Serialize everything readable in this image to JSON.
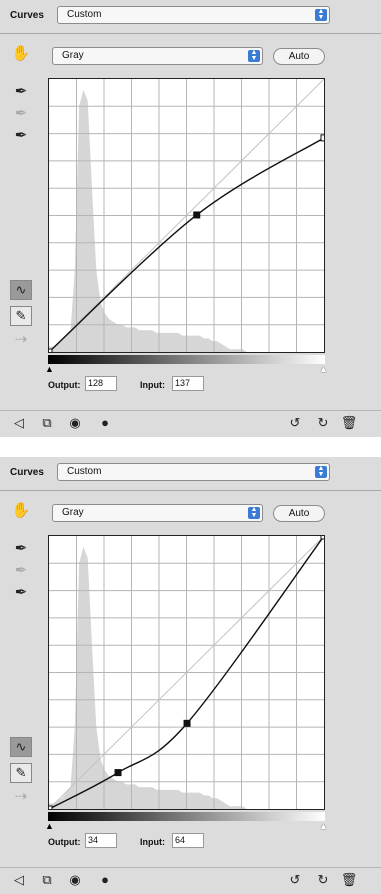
{
  "panels": [
    {
      "header": "Curves",
      "preset": "Custom",
      "channel": "Gray",
      "auto_label": "Auto",
      "output_label": "Output:",
      "output_value": "128",
      "input_label": "Input:",
      "input_value": "137",
      "curve_points": [
        [
          0,
          0
        ],
        [
          137,
          128
        ],
        [
          255,
          200
        ]
      ]
    },
    {
      "header": "Curves",
      "preset": "Custom",
      "channel": "Gray",
      "auto_label": "Auto",
      "output_label": "Output:",
      "output_value": "34",
      "input_label": "Input:",
      "input_value": "64",
      "curve_points": [
        [
          0,
          0
        ],
        [
          64,
          34
        ],
        [
          128,
          80
        ],
        [
          255,
          255
        ]
      ]
    }
  ],
  "icons": {
    "stepper": "⇕",
    "target_adjust": "hand-icon",
    "eyedroppers": [
      "black-eyedropper-icon",
      "gray-eyedropper-icon",
      "white-eyedropper-icon"
    ],
    "curve_tools": [
      "curve-point-tool-icon",
      "pencil-tool-icon",
      "smooth-icon"
    ],
    "bottom": [
      "back-icon",
      "clip-icon",
      "mask-eye-icon",
      "visibility-icon",
      "reset-view-icon",
      "reset-icon",
      "trash-icon"
    ]
  }
}
